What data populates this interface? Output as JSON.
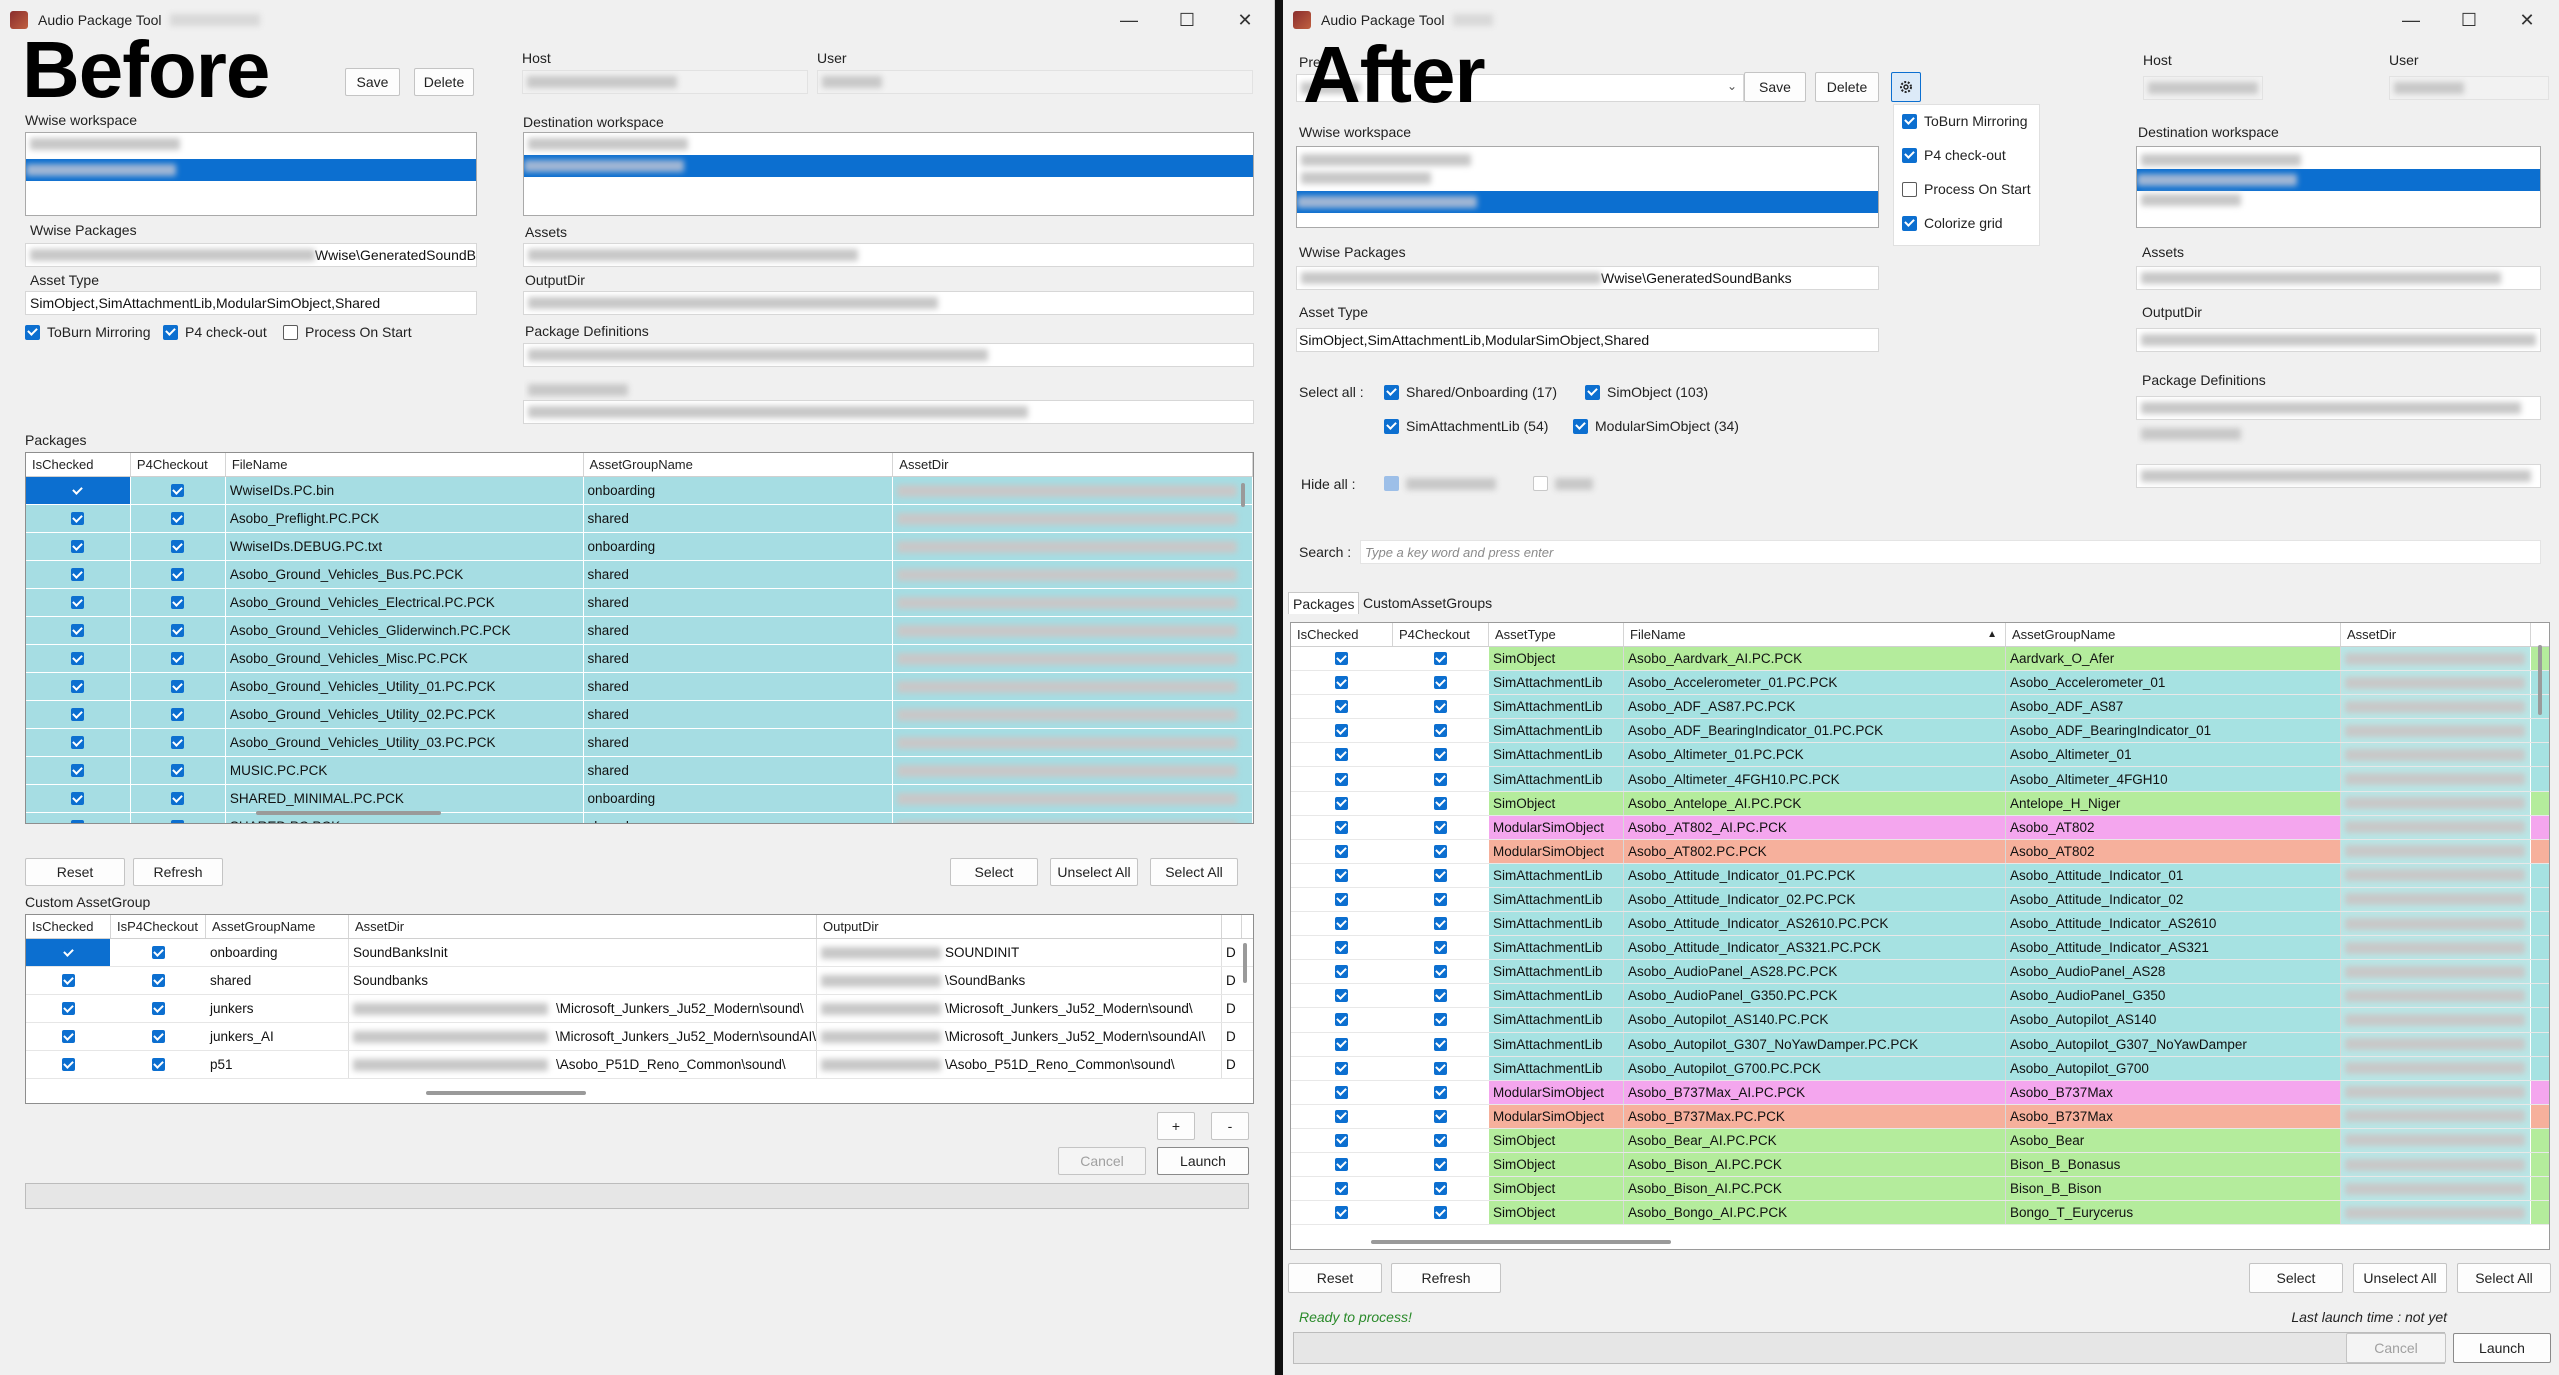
{
  "left": {
    "window_title": "Audio Package Tool",
    "stamp": "Before",
    "save_label": "Save",
    "delete_label": "Delete",
    "host_label": "Host",
    "user_label": "User",
    "wwise_workspace_label": "Wwise workspace",
    "destination_workspace_label": "Destination workspace",
    "wwise_packages_label": "Wwise Packages",
    "wwise_packages_value": "Wwise\\GeneratedSoundB",
    "assets_label": "Assets",
    "asset_type_label": "Asset Type",
    "asset_type_value": "SimObject,SimAttachmentLib,ModularSimObject,Shared",
    "outputdir_label": "OutputDir",
    "package_definitions_label": "Package Definitions",
    "options": [
      {
        "label": "ToBurn Mirroring",
        "checked": true
      },
      {
        "label": "P4 check-out",
        "checked": true
      },
      {
        "label": "Process On Start",
        "checked": false
      }
    ],
    "packages_label": "Packages",
    "packages_columns": [
      "IsChecked",
      "P4Checkout",
      "FileName",
      "AssetGroupName",
      "AssetDir"
    ],
    "packages_rows": [
      {
        "file": "WwiseIDs.PC.bin",
        "group": "onboarding"
      },
      {
        "file": "Asobo_Preflight.PC.PCK",
        "group": "shared"
      },
      {
        "file": "WwiseIDs.DEBUG.PC.txt",
        "group": "onboarding"
      },
      {
        "file": "Asobo_Ground_Vehicles_Bus.PC.PCK",
        "group": "shared"
      },
      {
        "file": "Asobo_Ground_Vehicles_Electrical.PC.PCK",
        "group": "shared"
      },
      {
        "file": "Asobo_Ground_Vehicles_Gliderwinch.PC.PCK",
        "group": "shared"
      },
      {
        "file": "Asobo_Ground_Vehicles_Misc.PC.PCK",
        "group": "shared"
      },
      {
        "file": "Asobo_Ground_Vehicles_Utility_01.PC.PCK",
        "group": "shared"
      },
      {
        "file": "Asobo_Ground_Vehicles_Utility_02.PC.PCK",
        "group": "shared"
      },
      {
        "file": "Asobo_Ground_Vehicles_Utility_03.PC.PCK",
        "group": "shared"
      },
      {
        "file": "MUSIC.PC.PCK",
        "group": "shared"
      },
      {
        "file": "SHARED_MINIMAL.PC.PCK",
        "group": "onboarding"
      },
      {
        "file": "SHARED.PC.PCK",
        "group": "shared"
      }
    ],
    "reset_label": "Reset",
    "refresh_label": "Refresh",
    "select_label": "Select",
    "unselect_all_label": "Unselect All",
    "select_all_label": "Select All",
    "custom_group_label": "Custom AssetGroup",
    "custom_columns": [
      "IsChecked",
      "IsP4Checkout",
      "AssetGroupName",
      "AssetDir",
      "OutputDir"
    ],
    "custom_rows": [
      {
        "group": "onboarding",
        "dir": "SoundBanksInit",
        "out": "SOUNDINIT"
      },
      {
        "group": "shared",
        "dir": "Soundbanks",
        "out": "\\SoundBanks"
      },
      {
        "group": "junkers",
        "dir": "\\Microsoft_Junkers_Ju52_Modern\\sound\\",
        "out": "\\Microsoft_Junkers_Ju52_Modern\\sound\\"
      },
      {
        "group": "junkers_AI",
        "dir": "\\Microsoft_Junkers_Ju52_Modern\\soundAI\\",
        "out": "\\Microsoft_Junkers_Ju52_Modern\\soundAI\\"
      },
      {
        "group": "p51",
        "dir": "\\Asobo_P51D_Reno_Common\\sound\\",
        "out": "\\Asobo_P51D_Reno_Common\\sound\\"
      }
    ],
    "col_d": "D",
    "plus_label": "+",
    "minus_label": "-",
    "cancel_label": "Cancel",
    "launch_label": "Launch"
  },
  "right": {
    "window_title": "Audio Package Tool",
    "stamp": "After",
    "preset_label": "Pre",
    "save_label": "Save",
    "delete_label": "Delete",
    "host_label": "Host",
    "user_label": "User",
    "settings_menu": [
      {
        "label": "ToBurn Mirroring",
        "checked": true
      },
      {
        "label": "P4 check-out",
        "checked": true
      },
      {
        "label": "Process On Start",
        "checked": false
      },
      {
        "label": "Colorize grid",
        "checked": true
      }
    ],
    "wwise_workspace_label": "Wwise workspace",
    "destination_workspace_label": "Destination workspace",
    "wwise_packages_label": "Wwise Packages",
    "wwise_packages_value": "Wwise\\GeneratedSoundBanks",
    "assets_label": "Assets",
    "asset_type_label": "Asset Type",
    "asset_type_value": "SimObject,SimAttachmentLib,ModularSimObject,Shared",
    "outputdir_label": "OutputDir",
    "package_definitions_label": "Package Definitions",
    "select_all_label": "Select all :",
    "select_all_options": [
      {
        "label": "Shared/Onboarding (17)",
        "checked": true
      },
      {
        "label": "SimObject (103)",
        "checked": true
      },
      {
        "label": "SimAttachmentLib (54)",
        "checked": true
      },
      {
        "label": "ModularSimObject (34)",
        "checked": true
      }
    ],
    "hide_all_label": "Hide all :",
    "search_label": "Search :",
    "search_placeholder": "Type a key word and press enter",
    "tabs": [
      "Packages",
      "CustomAssetGroups"
    ],
    "columns": [
      "IsChecked",
      "P4Checkout",
      "AssetType",
      "FileName",
      "AssetGroupName",
      "AssetDir"
    ],
    "sort_indicator": "▲",
    "rows": [
      {
        "type": "SimObject",
        "file": "Asobo_Aardvark_AI.PC.PCK",
        "group": "Aardvark_O_Afer"
      },
      {
        "type": "SimAttachmentLib",
        "file": "Asobo_Accelerometer_01.PC.PCK",
        "group": "Asobo_Accelerometer_01"
      },
      {
        "type": "SimAttachmentLib",
        "file": "Asobo_ADF_AS87.PC.PCK",
        "group": "Asobo_ADF_AS87"
      },
      {
        "type": "SimAttachmentLib",
        "file": "Asobo_ADF_BearingIndicator_01.PC.PCK",
        "group": "Asobo_ADF_BearingIndicator_01"
      },
      {
        "type": "SimAttachmentLib",
        "file": "Asobo_Altimeter_01.PC.PCK",
        "group": "Asobo_Altimeter_01"
      },
      {
        "type": "SimAttachmentLib",
        "file": "Asobo_Altimeter_4FGH10.PC.PCK",
        "group": "Asobo_Altimeter_4FGH10"
      },
      {
        "type": "SimObject",
        "file": "Asobo_Antelope_AI.PC.PCK",
        "group": "Antelope_H_Niger"
      },
      {
        "type": "ModularSimObject",
        "file": "Asobo_AT802_AI.PC.PCK",
        "group": "Asobo_AT802"
      },
      {
        "type": "ModularSimObject",
        "file": "Asobo_AT802.PC.PCK",
        "group": "Asobo_AT802"
      },
      {
        "type": "SimAttachmentLib",
        "file": "Asobo_Attitude_Indicator_01.PC.PCK",
        "group": "Asobo_Attitude_Indicator_01"
      },
      {
        "type": "SimAttachmentLib",
        "file": "Asobo_Attitude_Indicator_02.PC.PCK",
        "group": "Asobo_Attitude_Indicator_02"
      },
      {
        "type": "SimAttachmentLib",
        "file": "Asobo_Attitude_Indicator_AS2610.PC.PCK",
        "group": "Asobo_Attitude_Indicator_AS2610"
      },
      {
        "type": "SimAttachmentLib",
        "file": "Asobo_Attitude_Indicator_AS321.PC.PCK",
        "group": "Asobo_Attitude_Indicator_AS321"
      },
      {
        "type": "SimAttachmentLib",
        "file": "Asobo_AudioPanel_AS28.PC.PCK",
        "group": "Asobo_AudioPanel_AS28"
      },
      {
        "type": "SimAttachmentLib",
        "file": "Asobo_AudioPanel_G350.PC.PCK",
        "group": "Asobo_AudioPanel_G350"
      },
      {
        "type": "SimAttachmentLib",
        "file": "Asobo_Autopilot_AS140.PC.PCK",
        "group": "Asobo_Autopilot_AS140"
      },
      {
        "type": "SimAttachmentLib",
        "file": "Asobo_Autopilot_G307_NoYawDamper.PC.PCK",
        "group": "Asobo_Autopilot_G307_NoYawDamper"
      },
      {
        "type": "SimAttachmentLib",
        "file": "Asobo_Autopilot_G700.PC.PCK",
        "group": "Asobo_Autopilot_G700"
      },
      {
        "type": "ModularSimObject",
        "file": "Asobo_B737Max_AI.PC.PCK",
        "group": "Asobo_B737Max"
      },
      {
        "type": "ModularSimObject",
        "file": "Asobo_B737Max.PC.PCK",
        "group": "Asobo_B737Max"
      },
      {
        "type": "SimObject",
        "file": "Asobo_Bear_AI.PC.PCK",
        "group": "Asobo_Bear"
      },
      {
        "type": "SimObject",
        "file": "Asobo_Bison_AI.PC.PCK",
        "group": "Bison_B_Bonasus"
      },
      {
        "type": "SimObject",
        "file": "Asobo_Bison_AI.PC.PCK",
        "group": "Bison_B_Bison"
      },
      {
        "type": "SimObject",
        "file": "Asobo_Bongo_AI.PC.PCK",
        "group": "Bongo_T_Eurycerus"
      }
    ],
    "row_colors": {
      "SimObject": "#b4ec9c",
      "SimAttachmentLib": "#a6e2e2",
      "ModularSimObject_a": "#f4a6ee",
      "ModularSimObject_b": "#f6b09c"
    },
    "reset_label": "Reset",
    "refresh_label": "Refresh",
    "select_label": "Select",
    "unselect_all_label": "Unselect All",
    "select_all_button_label": "Select All",
    "status_text": "Ready to process!",
    "last_launch_text": "Last launch time : not yet",
    "cancel_label": "Cancel",
    "launch_label": "Launch"
  },
  "colors": {
    "accent": "#0c6fd0",
    "left_grid_row": "#a6dde3",
    "status_green": "#2a8a2a"
  }
}
